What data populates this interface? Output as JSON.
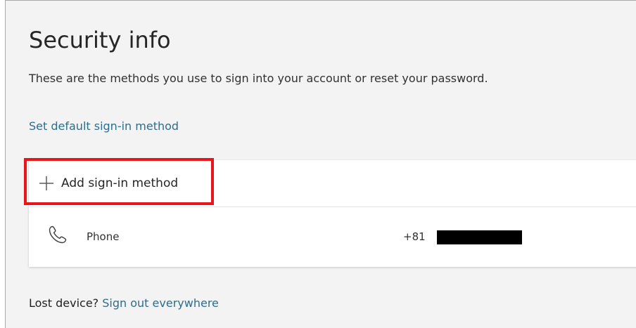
{
  "page": {
    "title": "Security info",
    "description": "These are the methods you use to sign into your account or reset your password.",
    "set_default_link": "Set default sign-in method"
  },
  "methods": {
    "add_label": "Add sign-in method",
    "add_icon": "plus-icon",
    "items": [
      {
        "icon": "phone-icon",
        "label": "Phone",
        "value": "+81",
        "value_redacted": true
      }
    ]
  },
  "footer": {
    "lost_device_text": "Lost device?",
    "sign_out_link": "Sign out everywhere"
  },
  "colors": {
    "link": "#2f6d8a",
    "highlight": "#e8151b",
    "background": "#f3f3f3",
    "card": "#ffffff"
  }
}
